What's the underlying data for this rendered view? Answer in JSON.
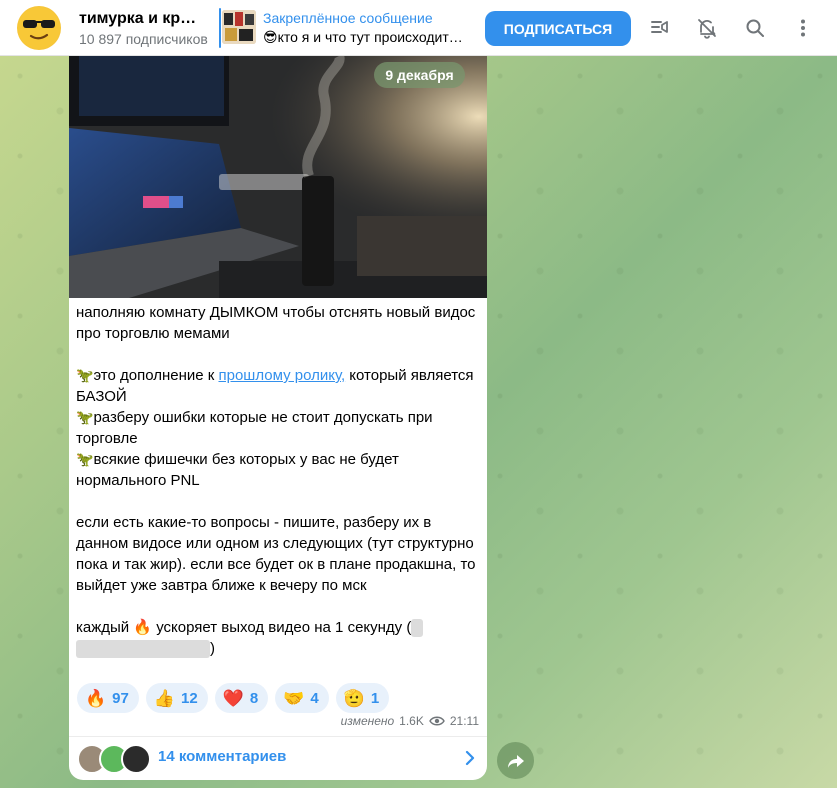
{
  "header": {
    "channel_name": "тимурка и кр…",
    "subscribers": "10 897 подписчиков",
    "pinned_title": "Закреплённое сообщение",
    "pinned_text": "😎кто я и что тут происходит…",
    "subscribe_label": "ПОДПИСАТЬСЯ"
  },
  "post": {
    "date_badge": "9 декабря",
    "para1": "наполняю комнату ДЫМКОМ чтобы отснять новый видос про торговлю мемами",
    "item1_before": "это дополнение к ",
    "item1_link": "прошлому ролику,",
    "item1_after": " который является БАЗОЙ",
    "item2": "разберу ошибки которые не стоит допускать при торговле",
    "item3": "всякие фишечки без которых у вас не будет нормального PNL",
    "para3": "если есть какие-то вопросы - пишите, разберу их в данном видосе или одном из следующих (тут структурно пока и так жир). если все будет ок в плане продакшна, то выйдет уже завтра ближе к вечеру по мск",
    "para4_before": "каждый ",
    "para4_emoji": "🔥",
    "para4_after": " ускоряет выход видео на 1 секунду (",
    "para4_close": ")",
    "dino_emoji": "🦖"
  },
  "reactions": [
    {
      "emoji": "🔥",
      "count": "97"
    },
    {
      "emoji": "👍",
      "count": "12"
    },
    {
      "emoji": "❤️",
      "count": "8"
    },
    {
      "emoji": "🤝",
      "count": "4"
    },
    {
      "emoji": "🫡",
      "count": "1"
    }
  ],
  "meta": {
    "edited": "изменено",
    "views": "1.6K",
    "time": "21:11"
  },
  "comments": {
    "label": "14 комментариев"
  },
  "colors": {
    "accent": "#3390ec",
    "muted": "#707579"
  }
}
